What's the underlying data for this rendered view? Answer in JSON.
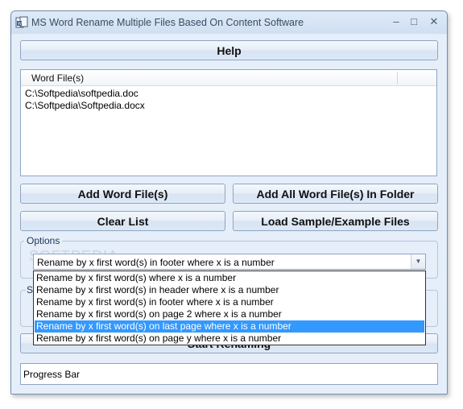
{
  "window": {
    "title": "MS Word Rename Multiple Files Based On Content Software",
    "minimize_glyph": "–",
    "maximize_glyph": "□",
    "close_glyph": "✕"
  },
  "buttons": {
    "help": "Help",
    "add_word_files": "Add Word File(s)",
    "add_all_in_folder": "Add All Word File(s) In Folder",
    "clear_list": "Clear List",
    "load_sample": "Load Sample/Example Files",
    "start_renaming": "Start Renaming"
  },
  "file_list": {
    "column_header": "Word File(s)",
    "items": [
      "C:\\Softpedia\\softpedia.doc",
      "C:\\Softpedia\\Softpedia.docx"
    ]
  },
  "options": {
    "group_label": "Options",
    "selected": "Rename by x first word(s) in footer where x is a number",
    "dropdown_items": [
      "Rename by x first word(s) where x is a number",
      "Rename by x first word(s) in header where x is a number",
      "Rename by x first word(s) in footer where x is a number",
      "Rename by x first word(s) on page 2 where x is a number",
      "Rename by x first word(s) on last page where x is a number",
      "Rename by x first word(s) on page y where x is a number"
    ],
    "highlighted_index": 4
  },
  "second_group_letter": "S",
  "progress": {
    "label": "Progress Bar"
  },
  "watermark": "SOFTPEDIA",
  "colors": {
    "window_bg": "#e5eef9",
    "highlight": "#3399ff",
    "border": "#8ea5c4"
  }
}
